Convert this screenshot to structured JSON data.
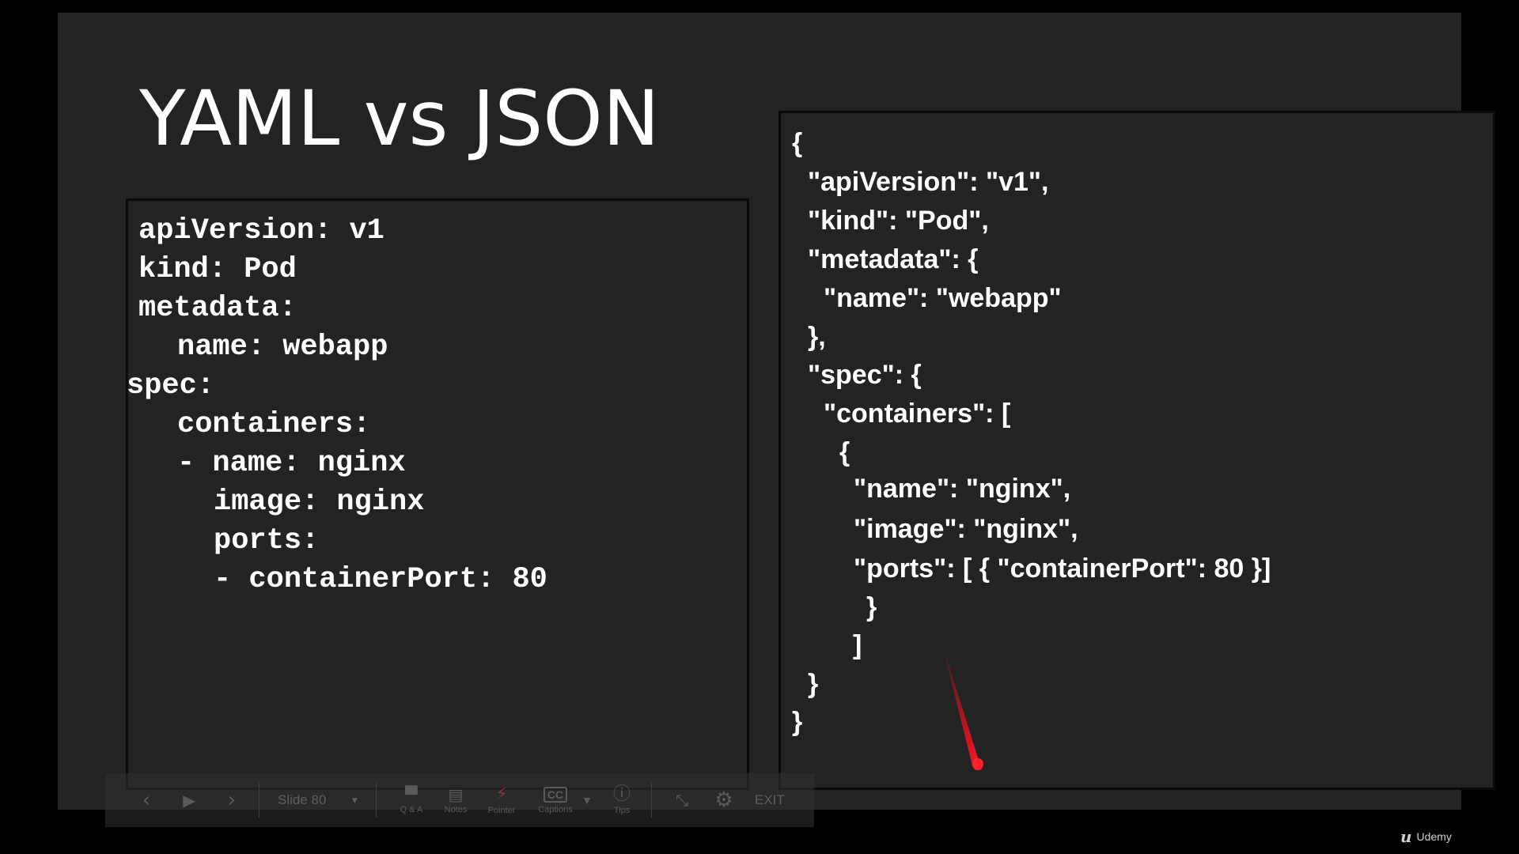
{
  "slide": {
    "title": "YAML vs JSON",
    "yaml_lines": [
      "apiVersion: v1",
      "kind: Pod",
      "metadata:",
      "name: webapp",
      "spec:",
      "containers:",
      "- name: nginx",
      "image: nginx",
      "ports:",
      "- containerPort: 80"
    ],
    "json_lines": [
      "{",
      "\"apiVersion\": \"v1\",",
      "\"kind\": \"Pod\",",
      "\"metadata\": {",
      "\"name\": \"webapp\"",
      "},",
      "\"spec\": {",
      "\"containers\": [",
      "{",
      "\"name\": \"nginx\",",
      "\"image\": \"nginx\",",
      "\"ports\": [ { \"containerPort\": 80 }]",
      "}",
      "]",
      "}",
      "}"
    ]
  },
  "controls": {
    "slide_selector": "Slide 80",
    "qa_label": "Q & A",
    "notes_label": "Notes",
    "pointer_label": "Pointer",
    "captions_label": "Captions",
    "tips_label": "Tips",
    "exit_label": "EXIT"
  },
  "brand": {
    "name": "Udemy"
  },
  "colors": {
    "slide_background": "#232323",
    "text": "#ffffff",
    "laser_pointer": "#e0101e"
  },
  "icons": [
    "chevron-left-icon",
    "play-icon",
    "chevron-right-icon",
    "chat-icon",
    "notes-icon",
    "lightning-icon",
    "captions-icon",
    "info-icon",
    "collapse-icon",
    "gear-icon"
  ]
}
